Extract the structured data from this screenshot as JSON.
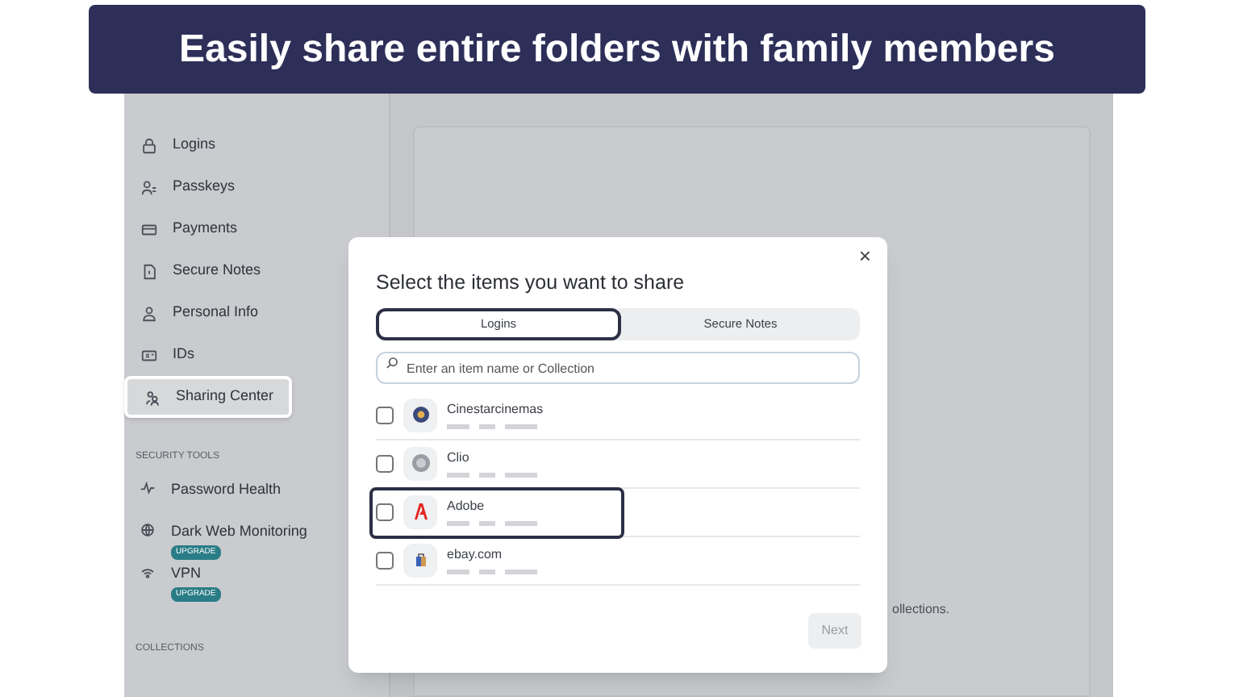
{
  "banner": {
    "title": "Easily share entire folders with family members"
  },
  "sidebar": {
    "items": [
      {
        "label": "Logins",
        "selected": false,
        "highlighted": false
      },
      {
        "label": "Passkeys",
        "selected": false,
        "highlighted": false
      },
      {
        "label": "Payments",
        "selected": false,
        "highlighted": false
      },
      {
        "label": "Secure Notes",
        "selected": false,
        "highlighted": false
      },
      {
        "label": "Personal Info",
        "selected": false,
        "highlighted": false
      },
      {
        "label": "IDs",
        "selected": false,
        "highlighted": false
      },
      {
        "label": "Sharing Center",
        "selected": true,
        "highlighted": true
      }
    ],
    "security_tools": {
      "heading": "SECURITY TOOLS",
      "items": [
        {
          "label": "Password Health"
        },
        {
          "label": "Dark Web Monitoring",
          "badge": "UPGRADE"
        },
        {
          "label": "VPN",
          "badge": "UPGRADE"
        }
      ]
    },
    "collections_heading": "COLLECTIONS"
  },
  "main": {
    "text": "ollections."
  },
  "dialog": {
    "title": "Select the items you want to share",
    "close": "×",
    "tabs": [
      {
        "label": "Logins",
        "selected": true,
        "highlighted": true
      },
      {
        "label": "Secure Notes",
        "selected": false,
        "highlighted": false
      }
    ],
    "search": {
      "placeholder": "Enter an item name or Collection"
    },
    "items": [
      {
        "name": "Cinestarcinemas",
        "checked": false,
        "highlighted": false
      },
      {
        "name": "Clio",
        "checked": false,
        "highlighted": false
      },
      {
        "name": "Adobe",
        "checked": false,
        "highlighted": true
      },
      {
        "name": "ebay.com",
        "checked": false,
        "highlighted": false
      }
    ],
    "next_button": {
      "label": "Next",
      "disabled": true
    }
  }
}
